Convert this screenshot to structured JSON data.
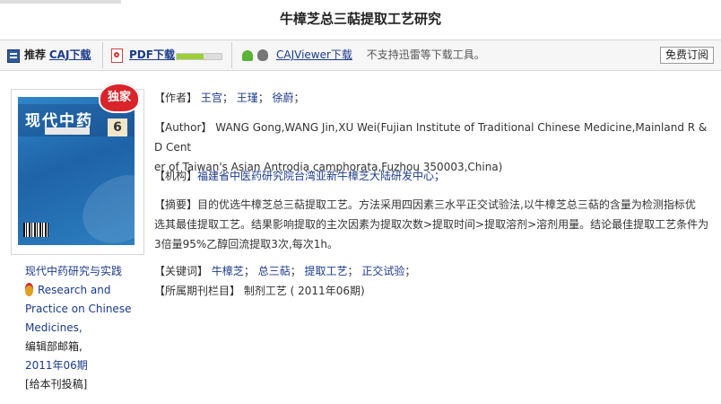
{
  "page": {
    "title": "牛樟芝总三萜提取工艺研究"
  },
  "toolbar": {
    "recommend_label": "推荐",
    "caj_download": "CAJ下载",
    "pdf_download": "PDF下载",
    "pdf_progress": 0.6,
    "cajviewer_download": "CAJViewer下载",
    "note": "不支持迅雷等下载工具。",
    "subscribe": "免费订阅",
    "icons": [
      "caj-book-icon",
      "pdf-icon",
      "android-icon",
      "apple-icon"
    ]
  },
  "cover": {
    "title": "现代中药",
    "issue": "6",
    "badge": "独家"
  },
  "journal": {
    "name_cn": "现代中药研究与实践",
    "name_en_1": "Research and",
    "name_en_2": "Practice on Chinese",
    "name_en_3": "Medicines,",
    "editorial": "编辑部邮箱,",
    "issue": "2011年06期",
    "submit": "[给本刊投稿]"
  },
  "article": {
    "authors_label": "【作者】",
    "authors": [
      "王宫",
      "王瑾",
      "徐蔚"
    ],
    "author_en_label": "【Author】",
    "author_en_line1": "WANG Gong,WANG Jin,XU Wei(Fujian Institute of Traditional Chinese Medicine,Mainland R & D Cent",
    "author_en_line2": "er of Taiwan's Asian Antrodia camphorata,Fuzhou 350003,China)",
    "institution_label": "【机构】",
    "institution": "福建省中医药研究院台湾亚新牛樟芝大陆研发中心；",
    "abstract_label": "【摘要】",
    "abstract_line1": "目的优选牛樟芝总三萜提取工艺。方法采用四因素三水平正交试验法,以牛樟芝总三萜的含量为检测指标优",
    "abstract_line2": "选其最佳提取工艺。结果影响提取的主次因素为提取次数>提取时间>提取溶剂>溶剂用量。结论最佳提取工艺条件为",
    "abstract_line3": "3倍量95%乙醇回流提取3次,每次1h。",
    "keywords_label": "【关键词】",
    "keywords": [
      "牛樟芝",
      "总三萜",
      "提取工艺",
      "正交试验"
    ],
    "column_label": "【所属期刊栏目】",
    "column": "制剂工艺 ( 2011年06期)"
  }
}
